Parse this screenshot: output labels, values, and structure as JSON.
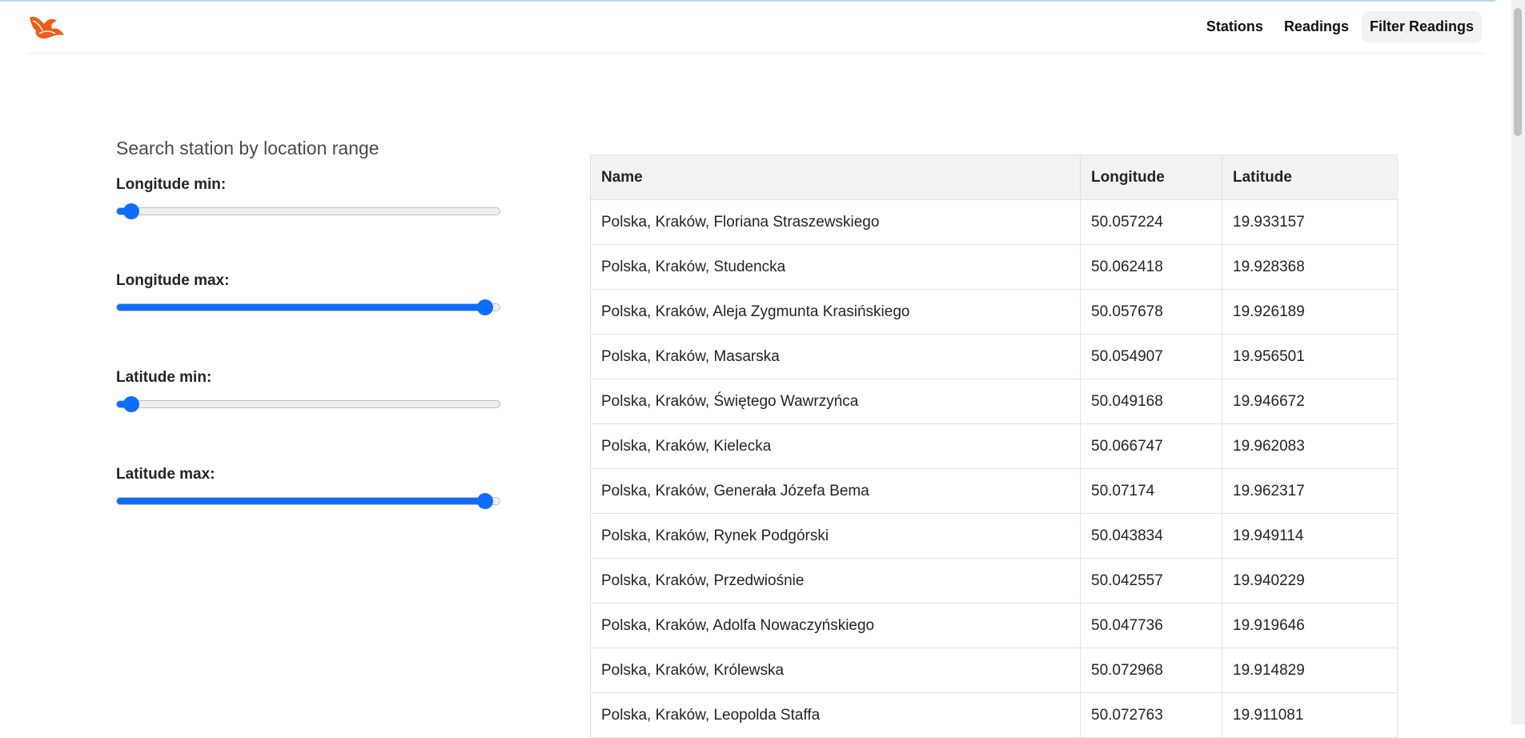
{
  "header": {
    "nav": [
      {
        "label": "Stations"
      },
      {
        "label": "Readings"
      },
      {
        "label": "Filter Readings"
      }
    ]
  },
  "filters": {
    "title": "Search station by location range",
    "longitude_min": {
      "label": "Longitude min:",
      "value_fraction": 0.04
    },
    "longitude_max": {
      "label": "Longitude max:",
      "value_fraction": 0.96
    },
    "latitude_min": {
      "label": "Latitude min:",
      "value_fraction": 0.04
    },
    "latitude_max": {
      "label": "Latitude max:",
      "value_fraction": 0.96
    }
  },
  "table": {
    "headers": [
      "Name",
      "Longitude",
      "Latitude"
    ],
    "rows": [
      [
        "Polska, Kraków, Floriana Straszewskiego",
        "50.057224",
        "19.933157"
      ],
      [
        "Polska, Kraków, Studencka",
        "50.062418",
        "19.928368"
      ],
      [
        "Polska, Kraków, Aleja Zygmunta Krasińskiego",
        "50.057678",
        "19.926189"
      ],
      [
        "Polska, Kraków, Masarska",
        "50.054907",
        "19.956501"
      ],
      [
        "Polska, Kraków, Świętego Wawrzyńca",
        "50.049168",
        "19.946672"
      ],
      [
        "Polska, Kraków, Kielecka",
        "50.066747",
        "19.962083"
      ],
      [
        "Polska, Kraków, Generała Józefa Bema",
        "50.07174",
        "19.962317"
      ],
      [
        "Polska, Kraków, Rynek Podgórski",
        "50.043834",
        "19.949114"
      ],
      [
        "Polska, Kraków, Przedwiośnie",
        "50.042557",
        "19.940229"
      ],
      [
        "Polska, Kraków, Adolfa Nowaczyńskiego",
        "50.047736",
        "19.919646"
      ],
      [
        "Polska, Kraków, Królewska",
        "50.072968",
        "19.914829"
      ],
      [
        "Polska, Kraków, Leopolda Staffa",
        "50.072763",
        "19.911081"
      ]
    ]
  },
  "colors": {
    "accent": "#0d6efd",
    "logo": "#f05a1a"
  },
  "icons": {
    "logo": "phoenix-logo-icon"
  }
}
